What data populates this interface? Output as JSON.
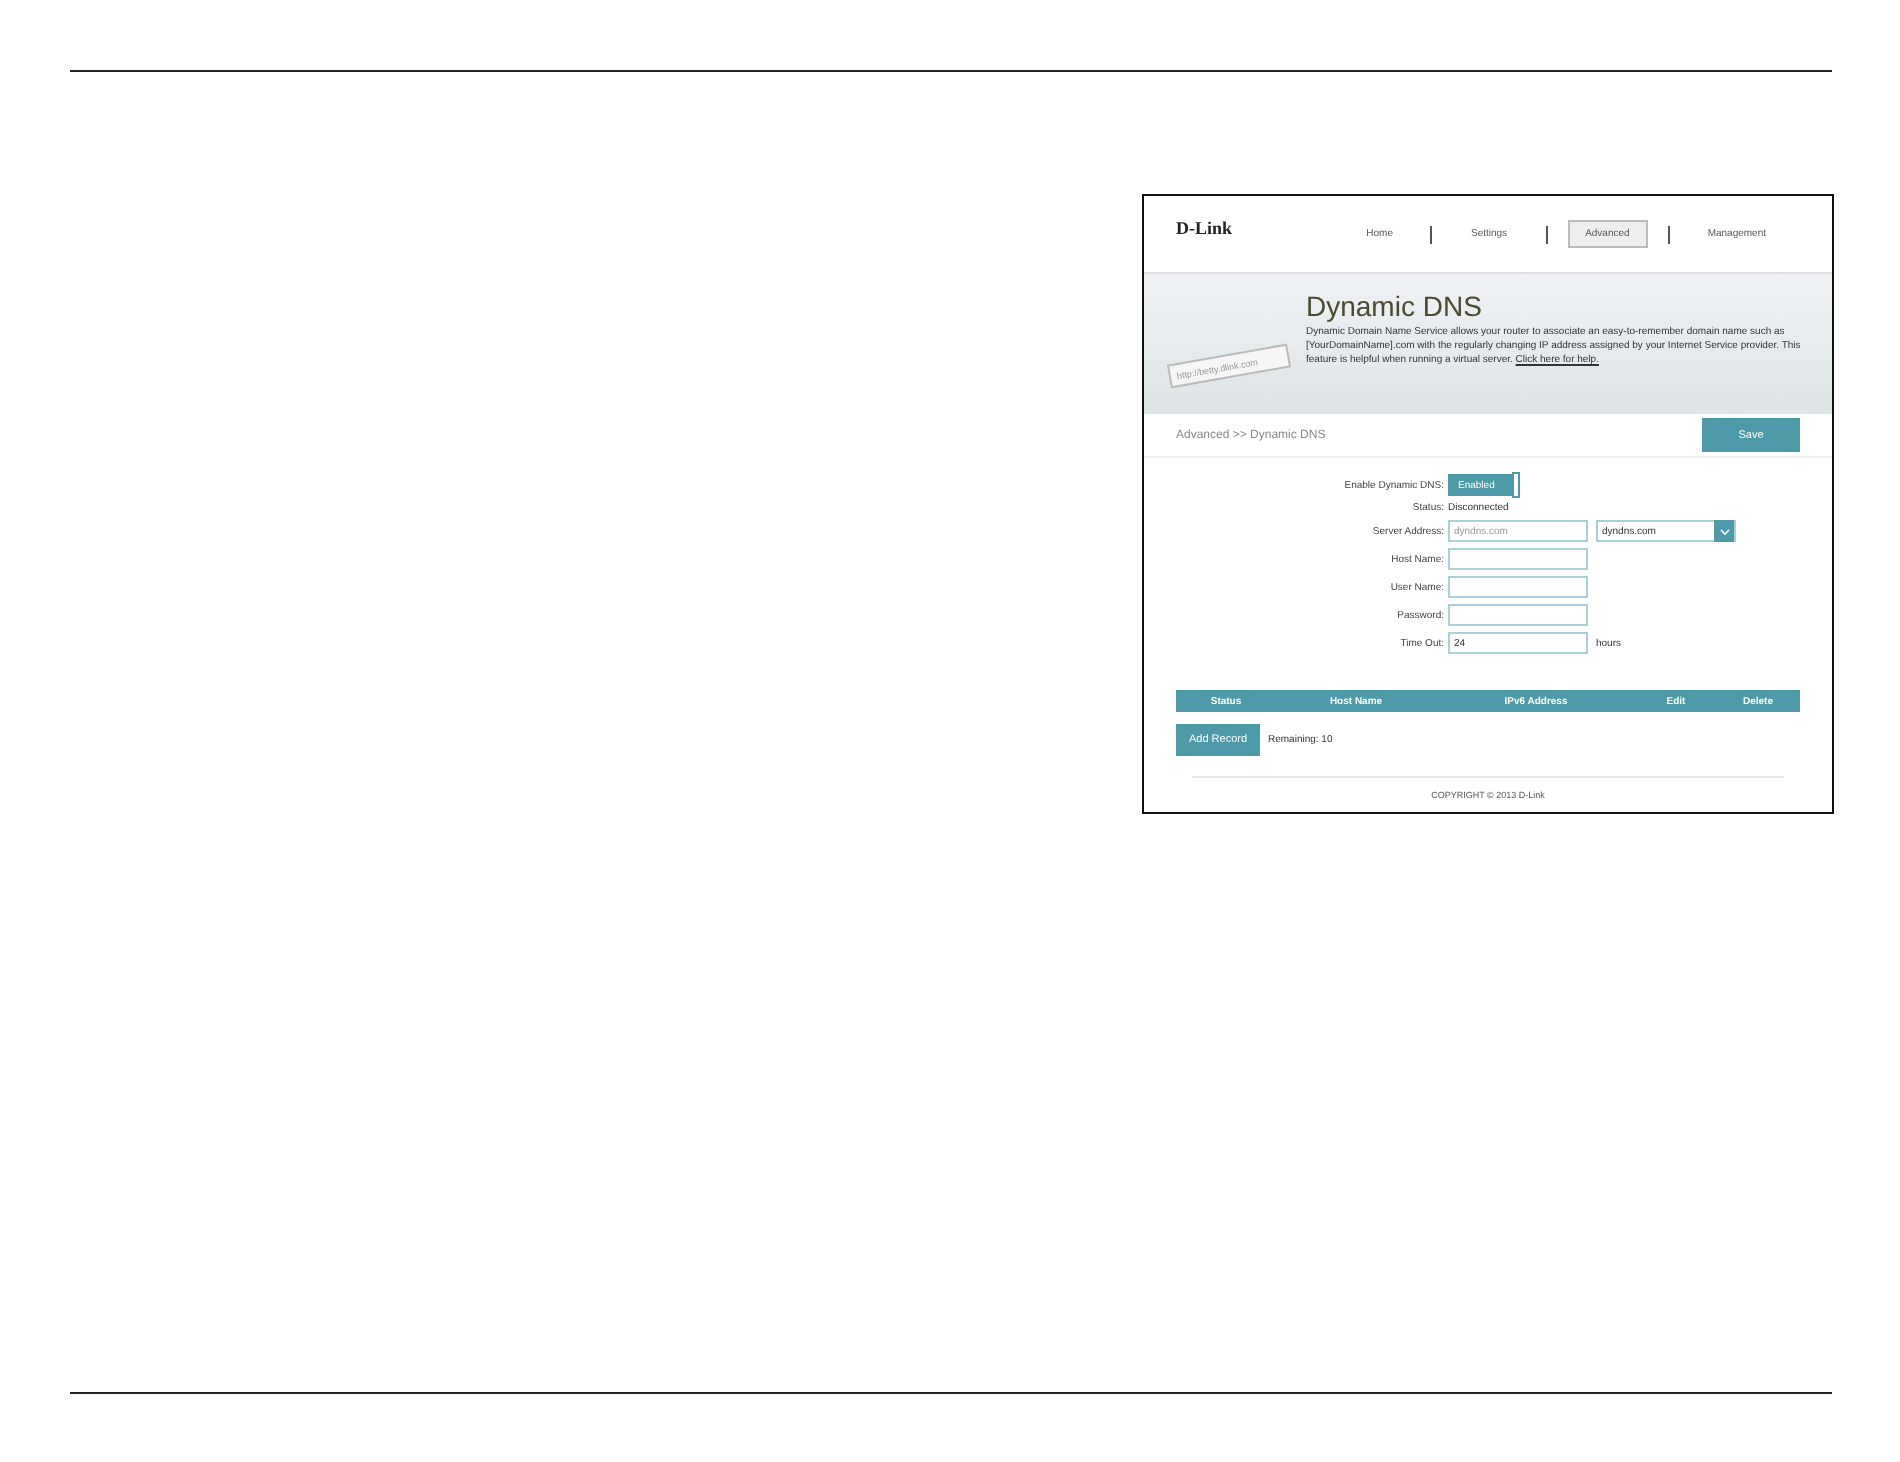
{
  "logo": "D-Link",
  "nav": [
    {
      "label": "Home",
      "selected": false
    },
    {
      "label": "Settings",
      "selected": false
    },
    {
      "label": "Advanced",
      "selected": true
    },
    {
      "label": "Management",
      "selected": false
    }
  ],
  "banner": {
    "url_example": "http://betty.dlink.com",
    "title": "Dynamic DNS",
    "description": "Dynamic Domain Name Service allows your router to associate an easy-to-remember domain name such as [YourDomainName].com with the regularly changing IP address assigned by your Internet Service provider. This feature is helpful when running a virtual server.",
    "link": "Click here for help."
  },
  "breadcrumb": "Advanced >> Dynamic DNS",
  "save_button": "Save",
  "form": {
    "enable": {
      "label": "Enable Dynamic DNS:",
      "value": "Enabled",
      "on": true
    },
    "status": {
      "label": "Status:",
      "value": "Disconnected"
    },
    "server_address": {
      "label": "Server Address:",
      "placeholder": "dyndns.com",
      "select_value": "dyndns.com"
    },
    "host_name": {
      "label": "Host Name:"
    },
    "user_name": {
      "label": "User Name:"
    },
    "password": {
      "label": "Password:"
    },
    "time_out": {
      "label": "Time Out:",
      "value": "24",
      "unit": "hours"
    }
  },
  "table": {
    "columns": [
      "Status",
      "Host Name",
      "IPv6 Address",
      "Edit",
      "Delete"
    ]
  },
  "add_record_button": "Add Record",
  "remaining": "Remaining: 10",
  "copyright": "COPYRIGHT © 2013 D-Link"
}
